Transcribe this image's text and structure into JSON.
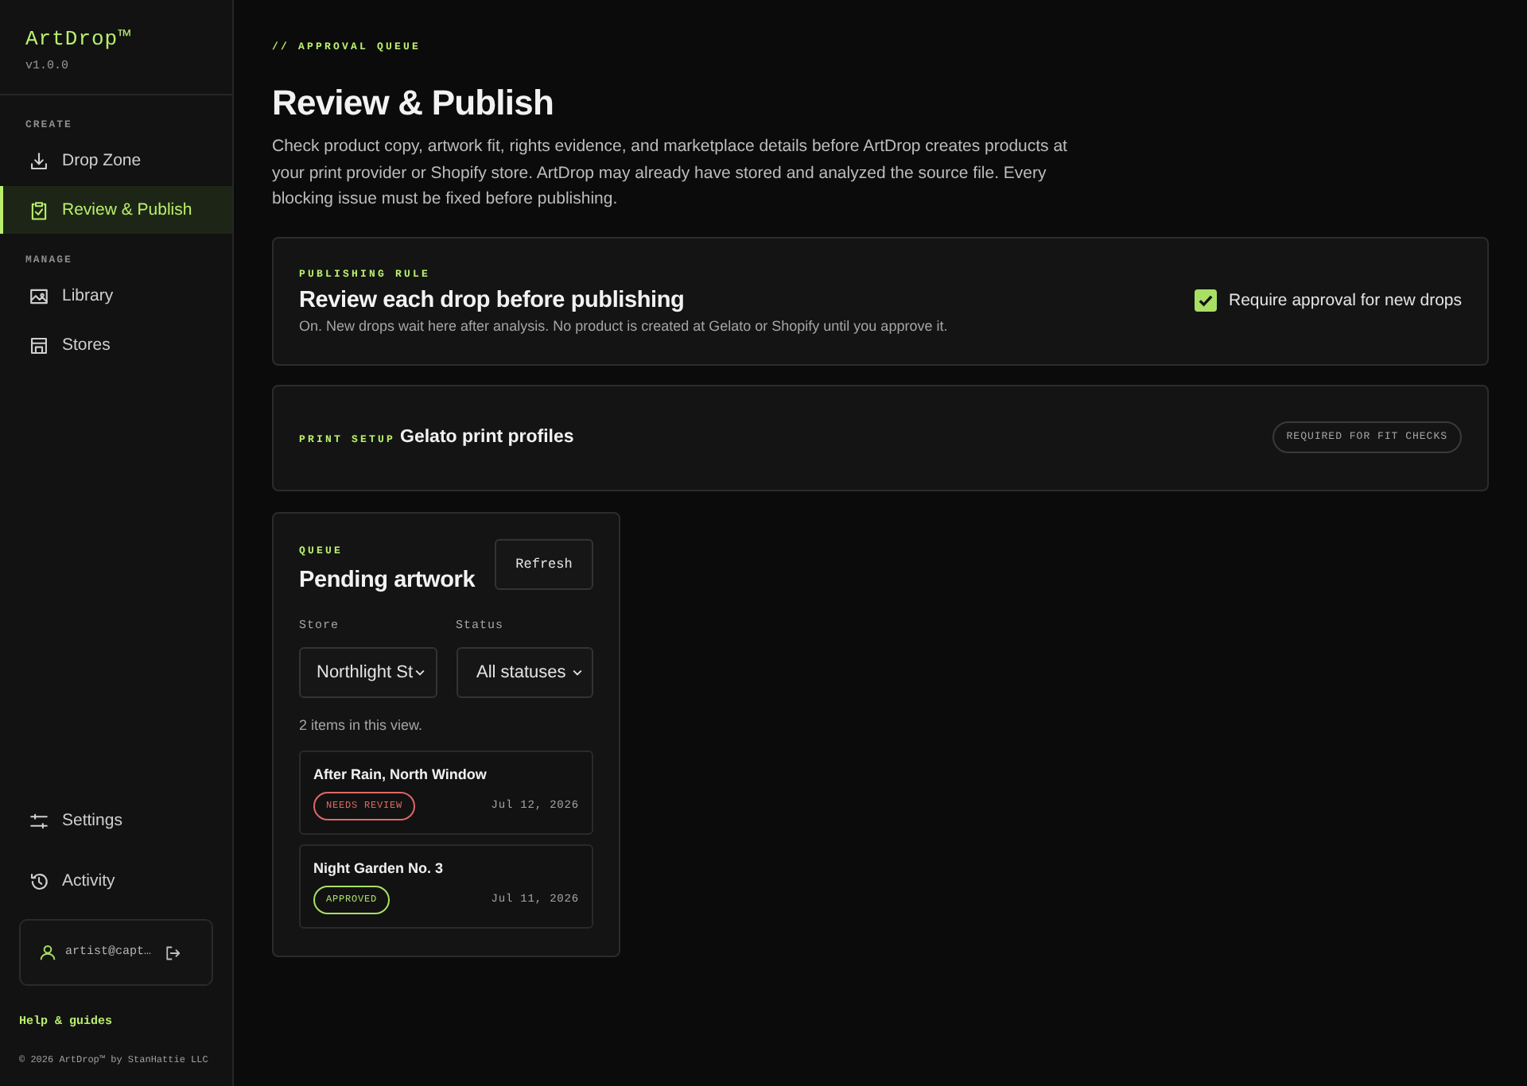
{
  "sidebar": {
    "brand": "ArtDrop™",
    "version": "v1.0.0",
    "sections": [
      {
        "heading": "CREATE",
        "items": [
          {
            "label": "Drop Zone",
            "selected": false
          },
          {
            "label": "Review & Publish",
            "selected": true
          }
        ]
      },
      {
        "heading": "MANAGE",
        "items": [
          {
            "label": "Library",
            "selected": false
          },
          {
            "label": "Stores",
            "selected": false
          }
        ]
      }
    ],
    "bottom_items": [
      {
        "label": "Settings",
        "selected": false
      },
      {
        "label": "Activity",
        "selected": false
      }
    ],
    "account": {
      "email": "artist@capt…"
    },
    "help_link": "Help & guides",
    "copyright": "© 2026 ArtDrop™ by StanHattie LLC"
  },
  "header": {
    "eyebrow": "// APPROVAL QUEUE",
    "title": "Review & Publish",
    "description": "Check product copy, artwork fit, rights evidence, and marketplace details before ArtDrop creates products at your print provider or Shopify store. ArtDrop may already have stored and analyzed the source file. Every blocking issue must be fixed before publishing."
  },
  "publishing_rule": {
    "eyebrow": "PUBLISHING RULE",
    "title": "Review each drop before publishing",
    "description": "On. New drops wait here after analysis. No product is created at Gelato or Shopify until you approve it.",
    "checkbox": {
      "label": "Require approval for new drops",
      "checked": true
    }
  },
  "print_setup": {
    "eyebrow": "PRINT SETUP",
    "title": "Gelato print profiles",
    "badge": "REQUIRED FOR FIT CHECKS"
  },
  "queue": {
    "eyebrow": "QUEUE",
    "title": "Pending artwork",
    "refresh_button": "Refresh",
    "filters": [
      {
        "label": "Store",
        "value": "Northlight St"
      },
      {
        "label": "Status",
        "value": "All statuses"
      }
    ],
    "count_text": "2 items in this view.",
    "items": [
      {
        "title": "After Rain, North Window",
        "status": "NEEDS REVIEW",
        "color": "#e06868",
        "date": "Jul 12, 2026"
      },
      {
        "title": "Night Garden No. 3",
        "status": "APPROVED",
        "color": "#a8e063",
        "date": "Jul 11, 2026"
      }
    ]
  }
}
